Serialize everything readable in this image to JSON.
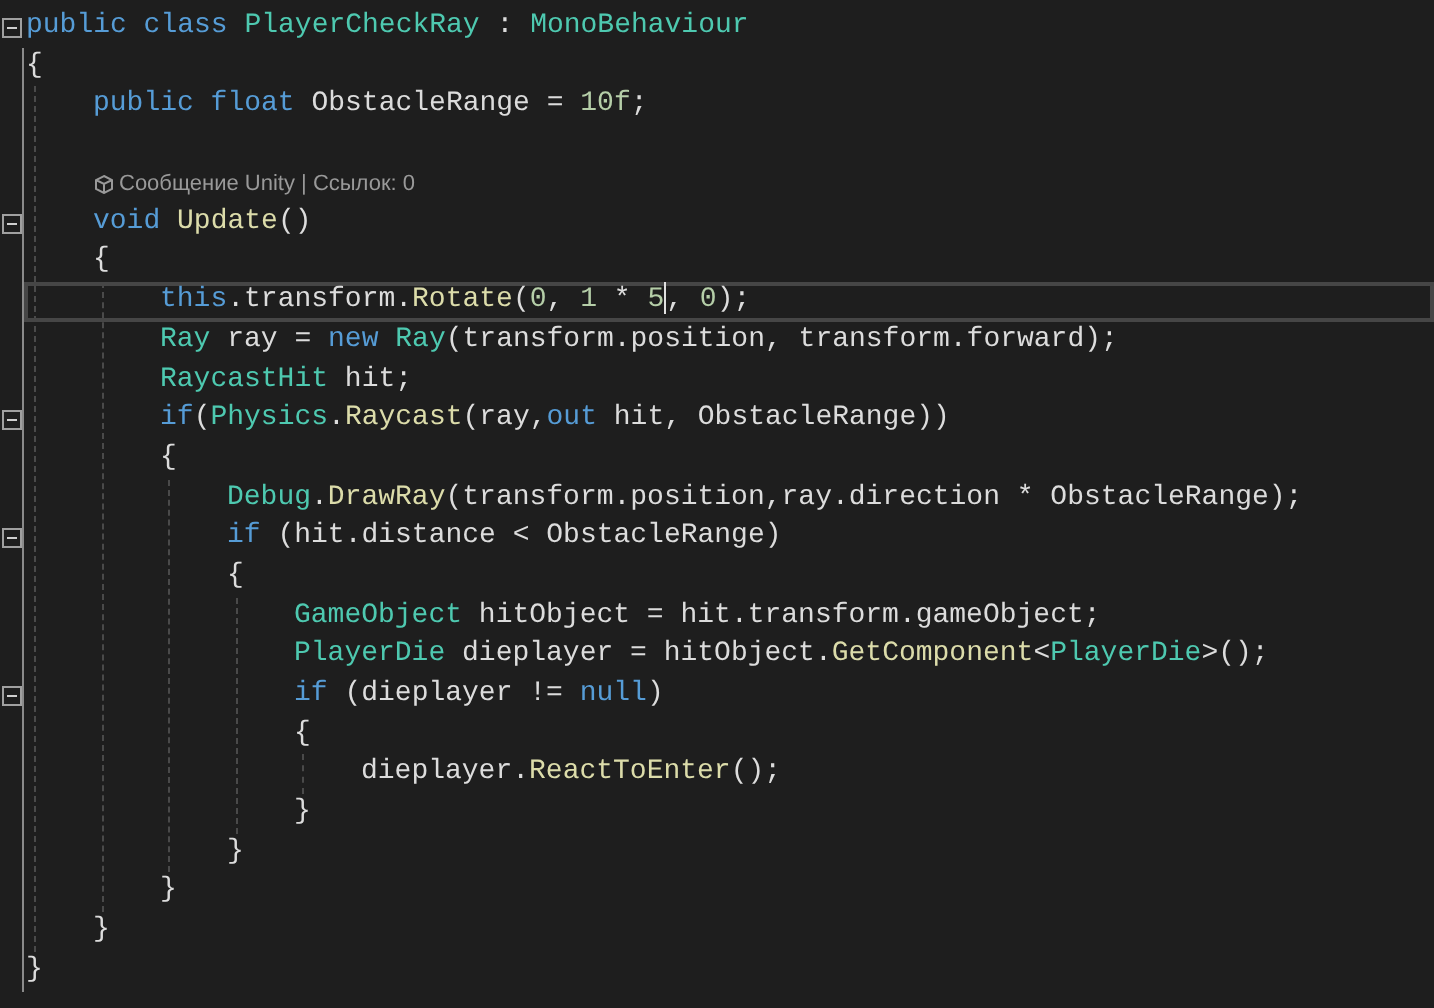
{
  "code": [
    {
      "kind": "code",
      "collapsed": false,
      "tokens": [
        {
          "kind": "keyword",
          "text": "public class "
        },
        {
          "kind": "type",
          "text": "PlayerCheckRay"
        },
        {
          "kind": "plain",
          "text": " : "
        },
        {
          "kind": "type",
          "text": "MonoBehaviour"
        }
      ]
    },
    {
      "kind": "code",
      "tokens": [
        {
          "kind": "plain",
          "text": "{"
        }
      ],
      "children": [
        {
          "kind": "code",
          "tokens": [
            {
              "kind": "keyword",
              "text": "public float"
            },
            {
              "kind": "plain",
              "text": " ObstacleRange = "
            },
            {
              "kind": "number",
              "text": "10f"
            },
            {
              "kind": "plain",
              "text": ";"
            }
          ]
        },
        {
          "kind": "blank"
        },
        {
          "kind": "codelens",
          "text": "Сообщение Unity | Ссылок: 0"
        },
        {
          "kind": "code",
          "collapsed": false,
          "tokens": [
            {
              "kind": "keyword",
              "text": "void "
            },
            {
              "kind": "method",
              "text": "Update"
            },
            {
              "kind": "plain",
              "text": "()"
            }
          ]
        },
        {
          "kind": "code",
          "tokens": [
            {
              "kind": "plain",
              "text": "{"
            }
          ],
          "children": [
            {
              "kind": "code",
              "current": true,
              "tokens": [
                {
                  "kind": "keyword",
                  "text": "this"
                },
                {
                  "kind": "plain",
                  "text": ".transform."
                },
                {
                  "kind": "method",
                  "text": "Rotate"
                },
                {
                  "kind": "plain",
                  "text": "("
                },
                {
                  "kind": "number",
                  "text": "0"
                },
                {
                  "kind": "plain",
                  "text": ", "
                },
                {
                  "kind": "number",
                  "text": "1"
                },
                {
                  "kind": "plain",
                  "text": " * "
                },
                {
                  "kind": "number",
                  "text": "5"
                },
                {
                  "kind": "caret"
                },
                {
                  "kind": "plain",
                  "text": ", "
                },
                {
                  "kind": "number",
                  "text": "0"
                },
                {
                  "kind": "plain",
                  "text": ");"
                }
              ]
            },
            {
              "kind": "code",
              "tokens": [
                {
                  "kind": "type",
                  "text": "Ray"
                },
                {
                  "kind": "plain",
                  "text": " ray = "
                },
                {
                  "kind": "keyword",
                  "text": "new "
                },
                {
                  "kind": "type",
                  "text": "Ray"
                },
                {
                  "kind": "plain",
                  "text": "(transform.position, transform.forward);"
                }
              ]
            },
            {
              "kind": "code",
              "tokens": [
                {
                  "kind": "type",
                  "text": "RaycastHit"
                },
                {
                  "kind": "plain",
                  "text": " hit;"
                }
              ]
            },
            {
              "kind": "code",
              "collapsed": false,
              "tokens": [
                {
                  "kind": "keyword",
                  "text": "if"
                },
                {
                  "kind": "plain",
                  "text": "("
                },
                {
                  "kind": "type",
                  "text": "Physics"
                },
                {
                  "kind": "plain",
                  "text": "."
                },
                {
                  "kind": "method",
                  "text": "Raycast"
                },
                {
                  "kind": "plain",
                  "text": "(ray,"
                },
                {
                  "kind": "keyword",
                  "text": "out"
                },
                {
                  "kind": "plain",
                  "text": " hit, ObstacleRange))"
                }
              ]
            },
            {
              "kind": "code",
              "tokens": [
                {
                  "kind": "plain",
                  "text": "{"
                }
              ],
              "children": [
                {
                  "kind": "code",
                  "tokens": [
                    {
                      "kind": "type",
                      "text": "Debug"
                    },
                    {
                      "kind": "plain",
                      "text": "."
                    },
                    {
                      "kind": "method",
                      "text": "DrawRay"
                    },
                    {
                      "kind": "plain",
                      "text": "(transform.position,ray.direction * ObstacleRange);"
                    }
                  ]
                },
                {
                  "kind": "code",
                  "collapsed": false,
                  "tokens": [
                    {
                      "kind": "keyword",
                      "text": "if"
                    },
                    {
                      "kind": "plain",
                      "text": " (hit.distance < ObstacleRange)"
                    }
                  ]
                },
                {
                  "kind": "code",
                  "tokens": [
                    {
                      "kind": "plain",
                      "text": "{"
                    }
                  ],
                  "children": [
                    {
                      "kind": "code",
                      "tokens": [
                        {
                          "kind": "type",
                          "text": "GameObject"
                        },
                        {
                          "kind": "plain",
                          "text": " hitObject = hit.transform.gameObject;"
                        }
                      ]
                    },
                    {
                      "kind": "code",
                      "tokens": [
                        {
                          "kind": "type",
                          "text": "PlayerDie"
                        },
                        {
                          "kind": "plain",
                          "text": " dieplayer = hitObject."
                        },
                        {
                          "kind": "method",
                          "text": "GetComponent"
                        },
                        {
                          "kind": "plain",
                          "text": "<"
                        },
                        {
                          "kind": "type",
                          "text": "PlayerDie"
                        },
                        {
                          "kind": "plain",
                          "text": ">();"
                        }
                      ]
                    },
                    {
                      "kind": "code",
                      "collapsed": false,
                      "tokens": [
                        {
                          "kind": "keyword",
                          "text": "if"
                        },
                        {
                          "kind": "plain",
                          "text": " (dieplayer != "
                        },
                        {
                          "kind": "keyword",
                          "text": "null"
                        },
                        {
                          "kind": "plain",
                          "text": ")"
                        }
                      ]
                    },
                    {
                      "kind": "code",
                      "tokens": [
                        {
                          "kind": "plain",
                          "text": "{"
                        }
                      ],
                      "children": [
                        {
                          "kind": "code",
                          "tokens": [
                            {
                              "kind": "plain",
                              "text": "dieplayer."
                            },
                            {
                              "kind": "method",
                              "text": "ReactToEnter"
                            },
                            {
                              "kind": "plain",
                              "text": "();"
                            }
                          ]
                        }
                      ]
                    },
                    {
                      "kind": "code",
                      "tokens": [
                        {
                          "kind": "plain",
                          "text": "}"
                        }
                      ]
                    }
                  ]
                },
                {
                  "kind": "code",
                  "tokens": [
                    {
                      "kind": "plain",
                      "text": "}"
                    }
                  ]
                }
              ]
            },
            {
              "kind": "code",
              "tokens": [
                {
                  "kind": "plain",
                  "text": "}"
                }
              ]
            }
          ]
        },
        {
          "kind": "code",
          "tokens": [
            {
              "kind": "plain",
              "text": "}"
            }
          ]
        }
      ]
    },
    {
      "kind": "code",
      "tokens": [
        {
          "kind": "plain",
          "text": "}"
        }
      ]
    }
  ]
}
